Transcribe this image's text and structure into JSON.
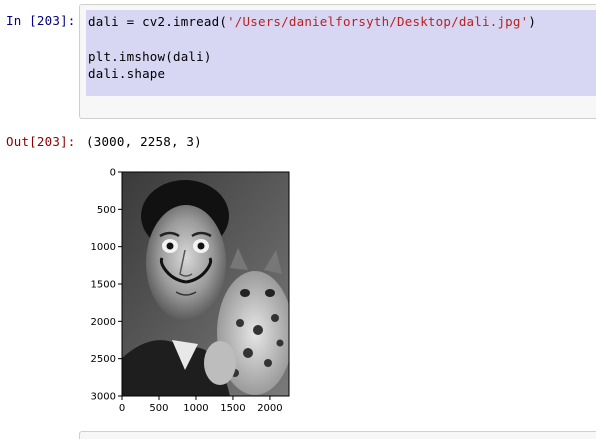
{
  "input_cell": {
    "prompt": "In [203]:",
    "code_line1_prefix": "dali = cv2.imread(",
    "code_line1_string": "'/Users/danielforsyth/Desktop/dali.jpg'",
    "code_line1_suffix": ")",
    "code_line2": "plt.imshow(dali)",
    "code_line3": "dali.shape",
    "selection_color": "#d7d7f3"
  },
  "output_cell": {
    "prompt": "Out[203]:",
    "value": "(3000, 2258, 3)"
  },
  "chart_data": {
    "type": "image",
    "title": "",
    "xlabel": "",
    "ylabel": "",
    "xlim": [
      0,
      2258
    ],
    "ylim": [
      3000,
      0
    ],
    "x_ticks": [
      "0",
      "500",
      "1000",
      "1500",
      "2000"
    ],
    "y_ticks": [
      "0",
      "500",
      "1000",
      "1500",
      "2000",
      "2500",
      "3000"
    ],
    "image_shape": [
      3000,
      2258,
      3
    ],
    "image_subject": "grayscale portrait of a mustached man holding an ocelot"
  }
}
